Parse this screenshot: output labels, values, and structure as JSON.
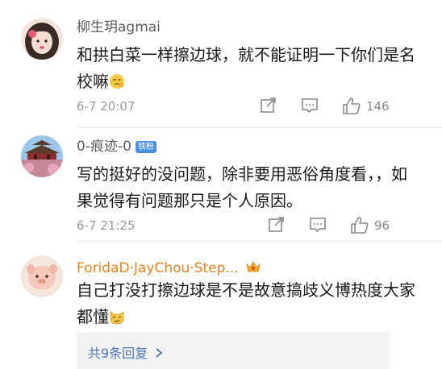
{
  "comments": [
    {
      "username": "柳生玥agmai",
      "text": "和拱白菜一样擦边球，就不能证明一下你们是名校嘛",
      "emoji": "pondering-face",
      "time": "6-7 20:07",
      "likes": "146"
    },
    {
      "username": "0-痕迹-0",
      "badge": "铁粉",
      "text": "写的挺好的没问题，除非要用恶俗角度看，，如果觉得有问题那只是个人原因。",
      "time": "6-7 21:25",
      "likes": "96"
    },
    {
      "username": "ForidaD·JayChou·Step...",
      "text": "自己打没打擦边球是不是故意搞歧义博热度大家都懂",
      "emoji": "smug-cat-face",
      "replies_label": "共9条回复"
    }
  ],
  "colors": {
    "username": "#5c5c5c",
    "vip_username": "#e8831f",
    "body_text": "#1a1a1a",
    "time": "#9a9a9a",
    "reply_link": "#4a76b8",
    "badge": "#4a90e2"
  },
  "icons": [
    "share-icon",
    "comment-icon",
    "like-icon",
    "crown-icon",
    "chevron-right-icon"
  ]
}
